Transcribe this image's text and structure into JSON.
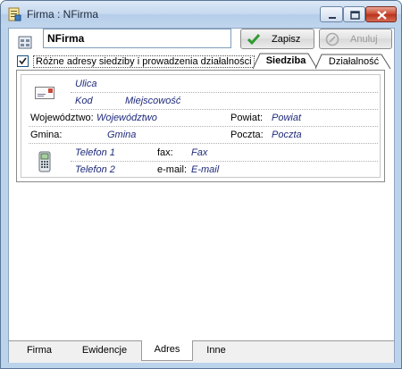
{
  "window": {
    "title": "Firma : NFirma",
    "icons": {
      "app": "form-app-icon",
      "minimize": "minimize-icon",
      "maximize": "maximize-icon",
      "close": "close-icon"
    }
  },
  "toolbar": {
    "name_value": "NFirma",
    "save_label": "Zapisz",
    "cancel_label": "Anuluj",
    "icons": {
      "document": "document-grid-icon",
      "save": "checkmark-icon",
      "cancel": "cancel-circle-icon"
    }
  },
  "options": {
    "different_addresses_label": "Różne adresy siedziby i prowadzenia działalności",
    "different_addresses_checked": true
  },
  "address_tabs": [
    {
      "label": "Siedziba",
      "active": true
    },
    {
      "label": "Działalność",
      "active": false
    }
  ],
  "address": {
    "street": "Ulica",
    "postal_code": "Kod",
    "city": "Miejscowość",
    "voivodeship_label": "Województwo:",
    "voivodeship": "Województwo",
    "district_label": "Powiat:",
    "district": "Powiat",
    "commune_label": "Gmina:",
    "commune": "Gmina",
    "post_office_label": "Poczta:",
    "post_office": "Poczta",
    "phone1": "Telefon 1",
    "fax_label": "fax:",
    "fax": "Fax",
    "phone2": "Telefon 2",
    "email_label": "e-mail:",
    "email": "E-mail",
    "icons": {
      "mail": "envelope-icon",
      "phone": "phone-icon"
    }
  },
  "bottom_tabs": [
    {
      "label": "Firma",
      "active": false
    },
    {
      "label": "Ewidencje",
      "active": false
    },
    {
      "label": "Adres",
      "active": true
    },
    {
      "label": "Inne",
      "active": false
    }
  ]
}
